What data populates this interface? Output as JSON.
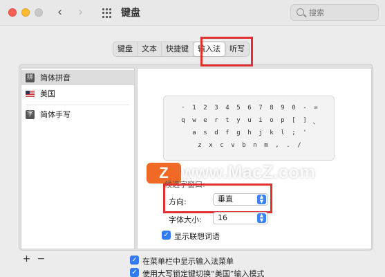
{
  "window": {
    "title": "键盘"
  },
  "search": {
    "placeholder": "搜索"
  },
  "nav": {
    "back": "‹",
    "forward": "›"
  },
  "tabs": [
    "键盘",
    "文本",
    "快捷键",
    "输入法",
    "听写"
  ],
  "sources": [
    {
      "glyph": "拼",
      "label": "简体拼音",
      "selected": true
    },
    {
      "glyph": "flag",
      "label": "美国",
      "selected": false
    },
    {
      "glyph": "字",
      "label": "简体手写",
      "selected": false
    }
  ],
  "keyboard": {
    "rows": [
      [
        "·",
        "1",
        "2",
        "3",
        "4",
        "5",
        "6",
        "7",
        "8",
        "9",
        "0",
        "-",
        "="
      ],
      [
        "q",
        "w",
        "e",
        "r",
        "t",
        "y",
        "u",
        "i",
        "o",
        "p",
        "[",
        "]",
        "、"
      ],
      [
        "a",
        "s",
        "d",
        "f",
        "g",
        "h",
        "j",
        "k",
        "l",
        ";",
        "'"
      ],
      [
        "z",
        "x",
        "c",
        "v",
        "b",
        "n",
        "m",
        ",",
        ".",
        "/"
      ]
    ]
  },
  "watermark": {
    "badge": "Z",
    "text": "www.MacZ.com"
  },
  "candidate": {
    "section_label": "候选字窗口:",
    "orientation_label": "方向:",
    "orientation_value": "垂直",
    "font_size_label": "字体大小:",
    "font_size_value": "16",
    "show_predictive_label": "显示联想词语"
  },
  "footer": {
    "add": "+",
    "remove": "−",
    "show_in_menu_label": "在菜单栏中显示输入法菜单",
    "caps_lock_label": "使用大写锁定键切换“美国”输入模式"
  },
  "colors": {
    "accent": "#2f7bf6",
    "highlight": "#de3030",
    "watermark": "#f06a25"
  }
}
